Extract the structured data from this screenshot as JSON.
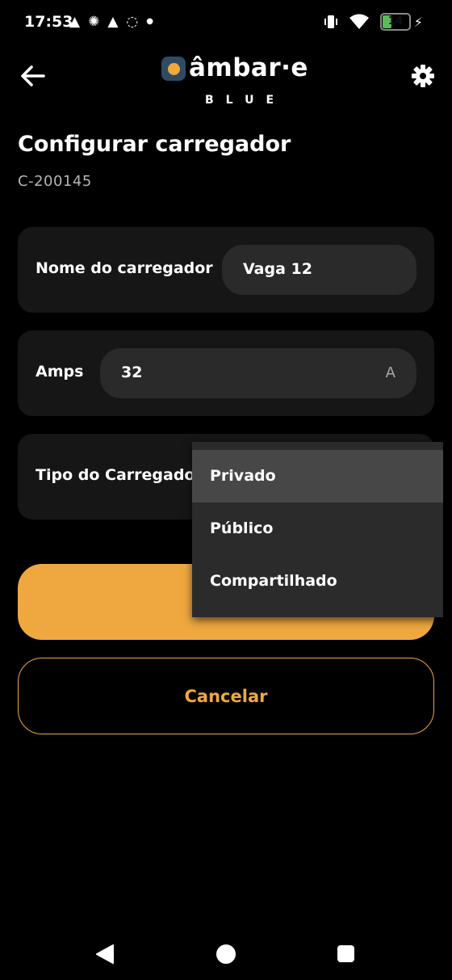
{
  "status_bar": {
    "time": "17:53",
    "left_icons": [
      "navigation-arrow-icon",
      "sparkle-icon",
      "navigation-arrow-icon",
      "badge-icon",
      "dot-icon"
    ],
    "battery_level": "14",
    "right_icons": [
      "vibrate-icon",
      "wifi-icon",
      "battery-icon",
      "charging-bolt-icon"
    ]
  },
  "header": {
    "brand_main": "âmbar·e",
    "brand_sub": "BLUE",
    "back_icon": "arrow-left-icon",
    "settings_icon": "gear-icon"
  },
  "page": {
    "title": "Configurar carregador",
    "charger_id": "C-200145"
  },
  "form": {
    "name": {
      "label": "Nome do carregador",
      "value": "Vaga 12"
    },
    "amps": {
      "label": "Amps",
      "value": "32",
      "unit": "A"
    },
    "type": {
      "label": "Tipo do Carregador"
    }
  },
  "dropdown": {
    "options": [
      "Privado",
      "Público",
      "Compartilhado"
    ],
    "selected": "Privado"
  },
  "buttons": {
    "cancel_label": "Cancelar"
  },
  "colors": {
    "accent": "#efa83f",
    "card_bg": "#161616",
    "field_bg": "#2a2a2a",
    "dropdown_bg": "#2b2b2b",
    "dropdown_selected_bg": "#474747"
  }
}
